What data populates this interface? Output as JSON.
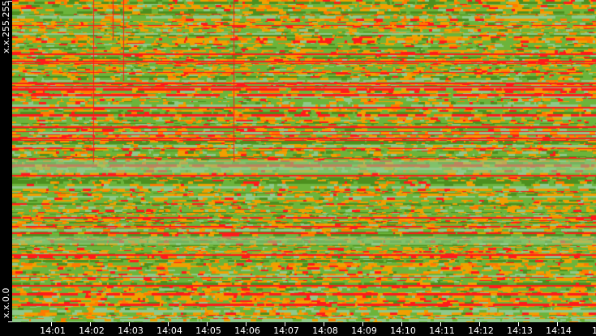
{
  "chart_data": {
    "type": "heatmap",
    "title": "",
    "xlabel": "",
    "ylabel": "",
    "y_tick_labels": [
      "x.x.255.255",
      "x.x.0.0"
    ],
    "x_tick_labels": [
      "14:01",
      "14:02",
      "14:03",
      "14:04",
      "14:05",
      "14:06",
      "14:07",
      "14:08",
      "14:09",
      "14:10",
      "14:11",
      "14:12",
      "14:13",
      "14:14",
      "14"
    ],
    "x_range": [
      "14:00",
      "14:15"
    ],
    "color_scale": [
      "#8fc98a",
      "#6cb43a",
      "#4d8f1e",
      "#f0a000",
      "#ff7a00",
      "#ff1a1a"
    ],
    "grid": false,
    "legend": "none"
  }
}
